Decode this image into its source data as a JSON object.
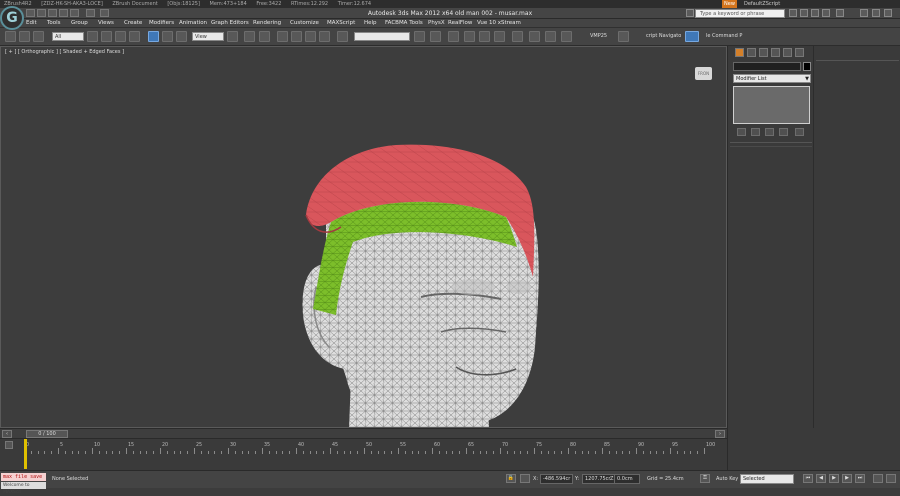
{
  "zbrush_strip": {
    "items": [
      "ZBrush4R2",
      "[ZDZ-HK-SH-AKA3-LOCE]",
      "ZBrush Document",
      "[Objs:18125]",
      "Mem:473+184",
      "Free:3422",
      "RTimes:12.292",
      "Timer:12.674"
    ],
    "new_tag": "New",
    "script": "DefaultZScript"
  },
  "titlebar": {
    "app_title": "Autodesk 3ds Max 2012 x64      old man 002 - musar.max",
    "search_placeholder": "Type a keyword or phrase"
  },
  "menu": {
    "items": [
      "Edit",
      "Tools",
      "Group",
      "Views",
      "Create",
      "Modifiers",
      "Animation",
      "Graph Editors",
      "Rendering",
      "Customize",
      "MAXScript",
      "Help",
      "FACBMA Tools",
      "PhysX",
      "RealFlow",
      "Vue 10 xStream"
    ]
  },
  "toolbar": {
    "filter_value": "All",
    "refcoord_value": "View",
    "named_sel_value": "",
    "vmp_label": "VMP25",
    "navigator_label": "cript Navigato",
    "command_label": "le Command P"
  },
  "viewport": {
    "label": "[ + ] [ Orthographic ] [ Shaded + Edged Faces ]",
    "viewcube_label": "FRON"
  },
  "command_panel": {
    "modifier_list_label": "Modifier List"
  },
  "timeline": {
    "frame_readout": "0 / 100",
    "ticks": [
      0,
      5,
      10,
      15,
      20,
      25,
      30,
      35,
      40,
      45,
      50,
      55,
      60,
      65,
      70,
      75,
      80,
      85,
      90,
      95,
      100
    ]
  },
  "status": {
    "maxscript_value": "max file save",
    "maxscript_sub": "Welcome to MAXScri",
    "selection_text": "None Selected",
    "x_label": "X:",
    "x_value": "-486.594cr",
    "y_label": "Y:",
    "y_value": "1207.75cr",
    "z_label": "Z:",
    "z_value": "0.0cm",
    "grid_text": "Grid = 25.4cm",
    "autokey_label": "Auto Key",
    "selected_value": "Selected"
  },
  "colors": {
    "hat_red": "#d9565c",
    "band_green": "#7cbe2a",
    "mesh_white": "#dedede",
    "accent_blue": "#3f78b8"
  }
}
